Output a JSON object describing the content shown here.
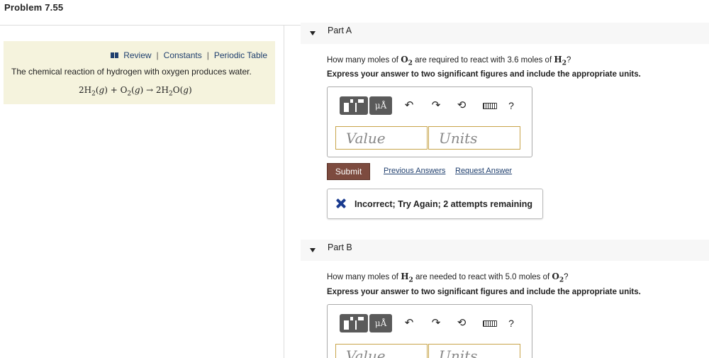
{
  "problem": {
    "title": "Problem 7.55"
  },
  "info": {
    "links": [
      "Review",
      "Constants",
      "Periodic Table"
    ],
    "description": "The chemical reaction of hydrogen with oxygen produces water."
  },
  "toolbar": {
    "templates_icon": "templates-icon",
    "mu_label": "μÅ",
    "undo_icon": "undo-icon",
    "redo_icon": "redo-icon",
    "reset_icon": "reset-icon",
    "keyboard_icon": "keyboard-icon",
    "help_label": "?"
  },
  "part_a": {
    "label": "Part A",
    "question_prefix": "How many moles of ",
    "question_mid": " are required to react with 3.6 moles of ",
    "question_end": "?",
    "instructions": "Express your answer to two significant figures and include the appropriate units.",
    "value_placeholder": "Value",
    "units_placeholder": "Units",
    "submit_label": "Submit",
    "previous_answers_label": "Previous Answers",
    "request_answer_label": "Request Answer",
    "feedback": "Incorrect; Try Again; 2 attempts remaining"
  },
  "part_b": {
    "label": "Part B",
    "question_prefix": "How many moles of ",
    "question_mid": " are needed to react with 5.0 moles of ",
    "question_end": "?",
    "instructions": "Express your answer to two significant figures and include the appropriate units.",
    "value_placeholder": "Value",
    "units_placeholder": "Units"
  },
  "colors": {
    "submit_bg": "#7d4b3f",
    "link": "#1f3f6e",
    "info_bg": "#f5f3dd",
    "field_border": "#c8a44a",
    "incorrect_icon": "#1a3b8f"
  }
}
